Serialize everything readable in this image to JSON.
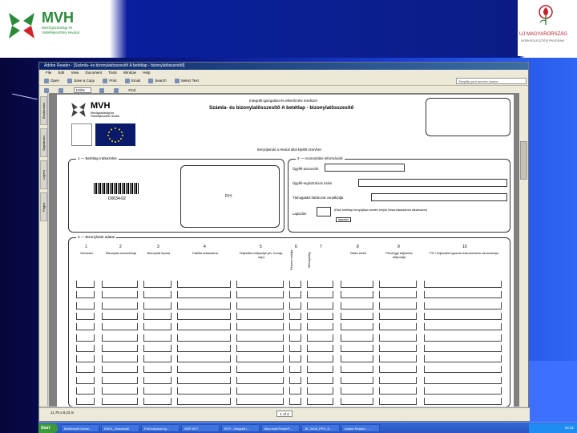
{
  "slide": {
    "logo_left_text": "MVH",
    "logo_left_sub": "Mezőgazdasági és Vidékfejlesztési Hivatal",
    "logo_right_text": "UJ MAGYARORSZÁG",
    "logo_right_sub": "VIDÉKFEJLESZTÉSI PROGRAM"
  },
  "window": {
    "title": "Adobe Reader - [Számla- és bizonylatösszesítő A betétlap - bizonylatösszesítő]",
    "menu": [
      "File",
      "Edit",
      "View",
      "Document",
      "Tools",
      "Window",
      "Help"
    ],
    "toolbar1": [
      "Open",
      "Save a Copy",
      "Print",
      "Email",
      "Search",
      "Select Text"
    ],
    "promo": "Simplify your service choice",
    "zoom": "103%",
    "find": "Find",
    "side_tabs": [
      "Bookmarks",
      "Signatures",
      "Layers",
      "Pages"
    ],
    "status_left": "11,75 x 8,23 in",
    "page_indicator": "1 of 2"
  },
  "form": {
    "header_line1": "Integrált igazgatási és ellenőrzési rendszer",
    "header_line2": "Számla- és bizonylatösszesítő A betétlap - bizonylatösszesítő",
    "mvh": "MVH",
    "mvh_sub": "Mezőgazdasági és Vidékfejlesztési Hivatal",
    "instruction": "Benyújtandó a Hivatal által kijelölt szervhez",
    "section1": "1 — Betétlap iratkezelés",
    "ph": "P.H.",
    "barcode_text": "D0034-02",
    "section2": "2 — Azonosítási információk",
    "field_azon": "Ügyfél-azonosító",
    "field_reg": "Ügyfél-regisztrációs szám",
    "field_hat": "Támogatási határozat vonalkódja",
    "field_lap": "Lapszám",
    "note": "(Első betétlap benyújtása esetén kérjük felsorolásszámot alkalmazni)",
    "lapszam_box": "lapszám",
    "section3": "3 — Bizonylatok adatai",
    "col_numbers": [
      "1",
      "2",
      "3",
      "4",
      "5",
      "6",
      "7",
      "8",
      "9",
      "10"
    ],
    "col_headers": [
      "Sorszám",
      "Bizonylat azonosítója",
      "Bizonylat típusa",
      "Kiállító adószáma",
      "Teljesítés időpontja (év, hónap, nap)",
      "Pénzes módja",
      "Mennyiség",
      "Nettó érték",
      "Pénzügyi teljesítés időpontja",
      "PG / teljesítést igazoló dokumentum azonosítója"
    ]
  },
  "taskbar": {
    "start": "Start",
    "tasks": [
      "Beérkezett üzene...",
      "EMVL_Összesítő",
      "Felhívásokat ny...",
      "SDR SET",
      "BTR - Integrált i...",
      "Microsoft PowerP...",
      "JE_2008_PPH_E...",
      "Adobe Reader - ..."
    ],
    "clock": "16:31"
  }
}
